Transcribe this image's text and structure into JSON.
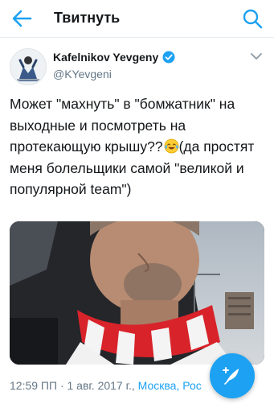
{
  "header": {
    "title": "Твитнуть",
    "back_icon": "arrow-left-icon",
    "search_icon": "search-icon"
  },
  "tweet": {
    "author_name": "Kafelnikov Yevgeny",
    "author_handle": "@KYevgeni",
    "verified": true,
    "text_part1": "Может \"махнуть\" в \"бомжатник\" на выходные и посмотреть на протекающую крышу??",
    "emoji": "face-with-tears-of-joy",
    "text_part2": "(да простят меня болельщики самой \"великой и популярной team\")",
    "timestamp": "12:59 ПП · 1 авг. 2017 г., ",
    "location": "Москва, Рос"
  },
  "colors": {
    "accent": "#1da1f2",
    "text": "#14171a",
    "secondary": "#657786"
  }
}
